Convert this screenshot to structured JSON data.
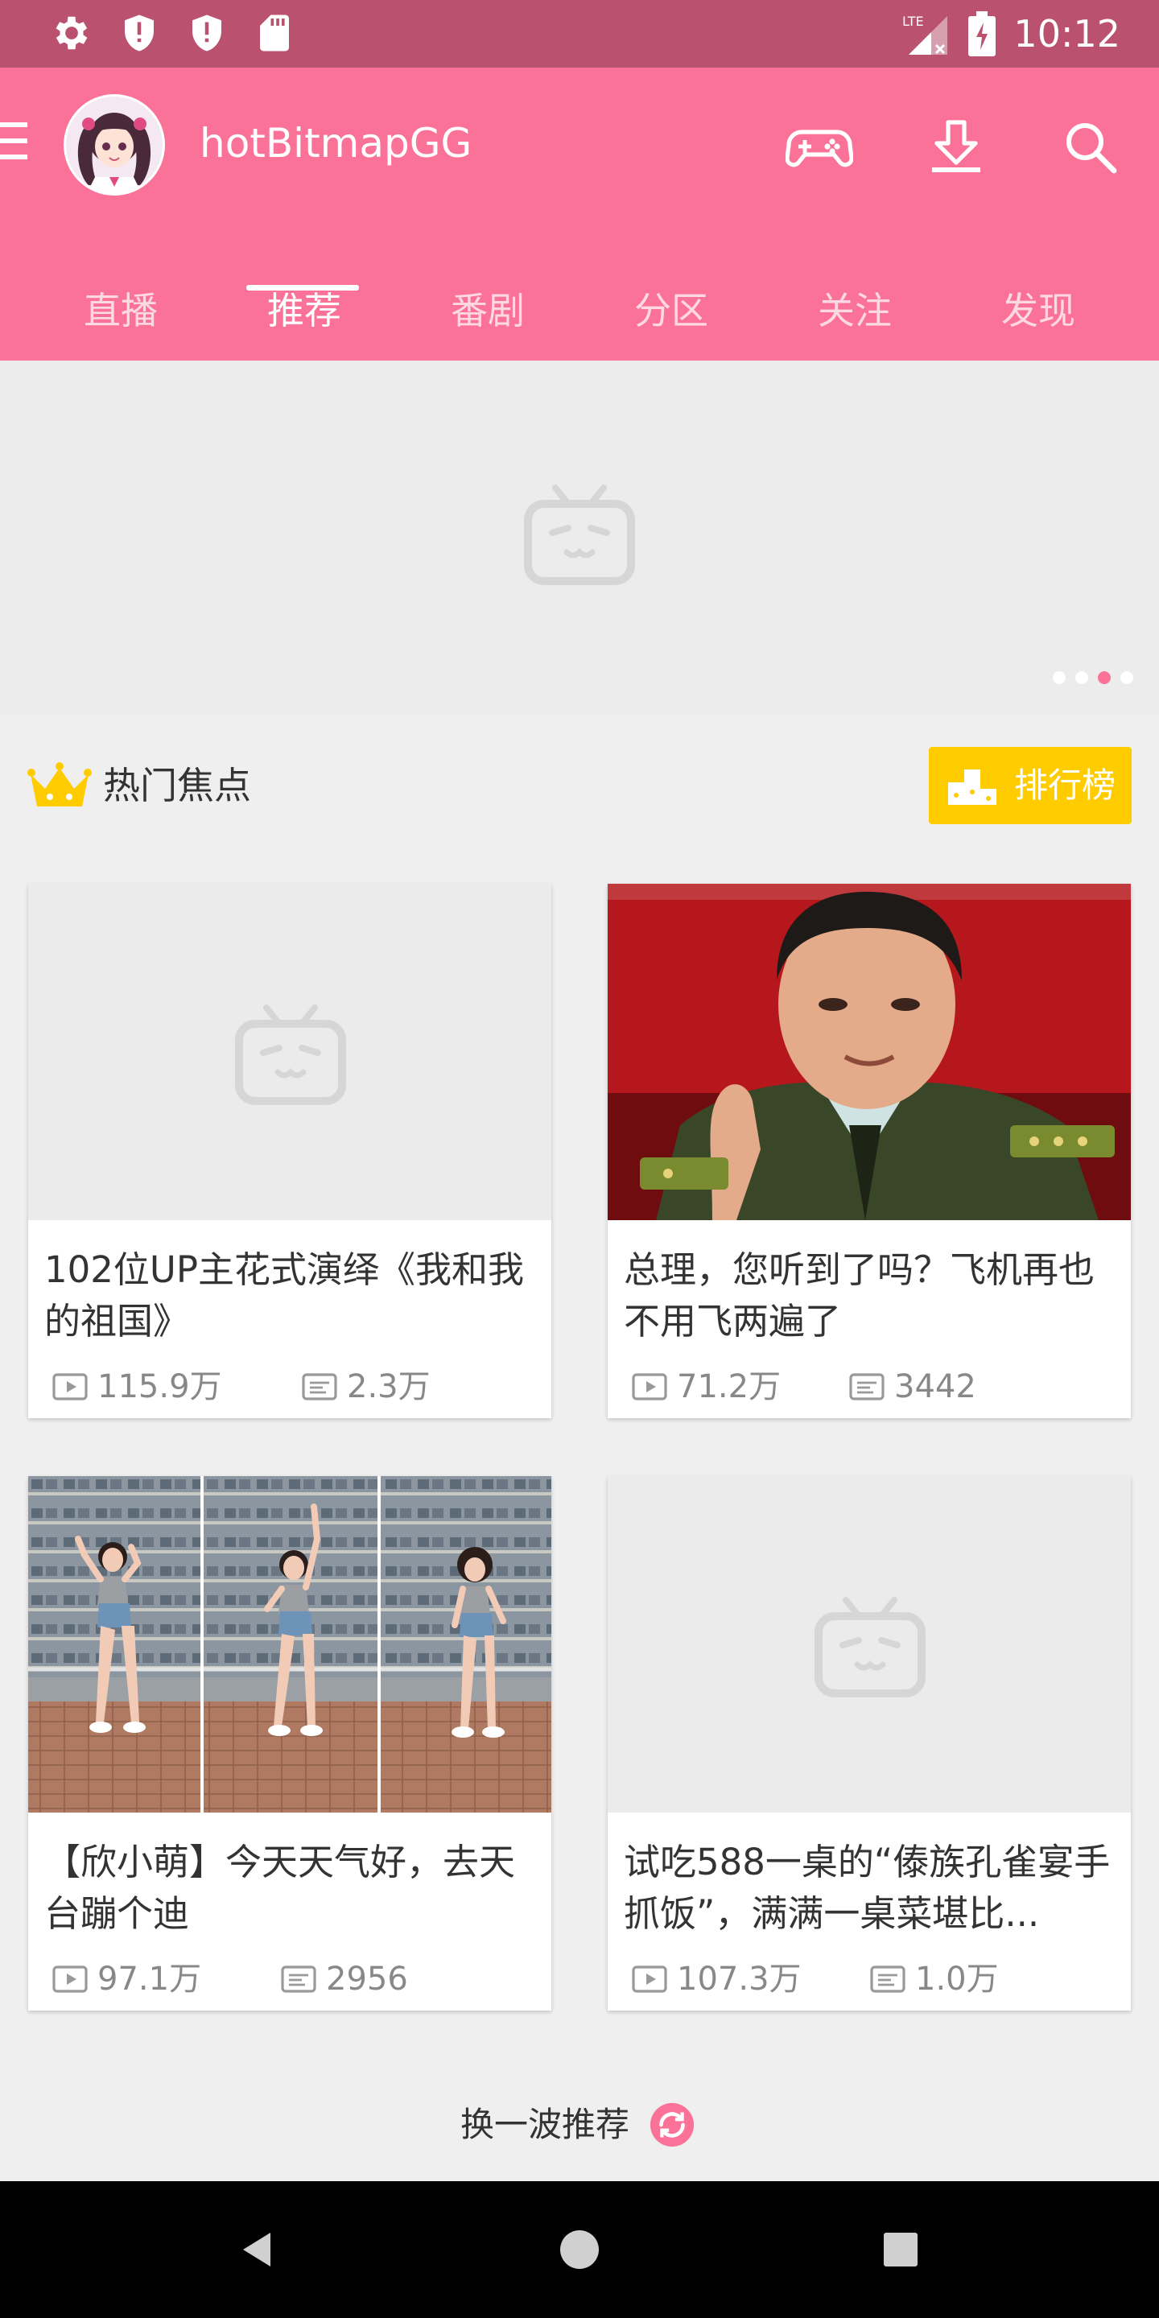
{
  "status_bar": {
    "time": "10:12",
    "network": "LTE",
    "icons": [
      "settings-icon",
      "shield-alert-icon",
      "shield-alert-icon",
      "sd-card-icon",
      "signal-icon",
      "battery-charging-icon"
    ]
  },
  "app_bar": {
    "user_name": "hotBitmapGG",
    "actions": [
      "game-controller-icon",
      "download-icon",
      "search-icon"
    ]
  },
  "tabs": [
    "直播",
    "推荐",
    "番剧",
    "分区",
    "关注",
    "发现"
  ],
  "active_tab": "推荐",
  "banner": {
    "dots": 4,
    "active_dot": 3
  },
  "section": {
    "title": "热门焦点",
    "rank_label": "排行榜"
  },
  "cards": [
    {
      "title": "102位UP主花式演绎《我和我的祖国》",
      "plays": "115.9万",
      "danmaku": "2.3万",
      "thumb": "placeholder"
    },
    {
      "title": "总理，您听到了吗？飞机再也不用飞两遍了",
      "plays": "71.2万",
      "danmaku": "3442",
      "thumb": "officer-photo"
    },
    {
      "title": "【欣小萌】今天天气好，去天台蹦个迪",
      "plays": "97.1万",
      "danmaku": "2956",
      "thumb": "dance-photo"
    },
    {
      "title": "试吃588一桌的“傣族孔雀宴手抓饭”，满满一桌菜堪比...",
      "plays": "107.3万",
      "danmaku": "1.0万",
      "thumb": "placeholder"
    }
  ],
  "refresh": {
    "label": "换一波推荐"
  },
  "colors": {
    "accent": "#fb7299",
    "status_bar": "#b9516f",
    "rank_button": "#ffcc00"
  }
}
